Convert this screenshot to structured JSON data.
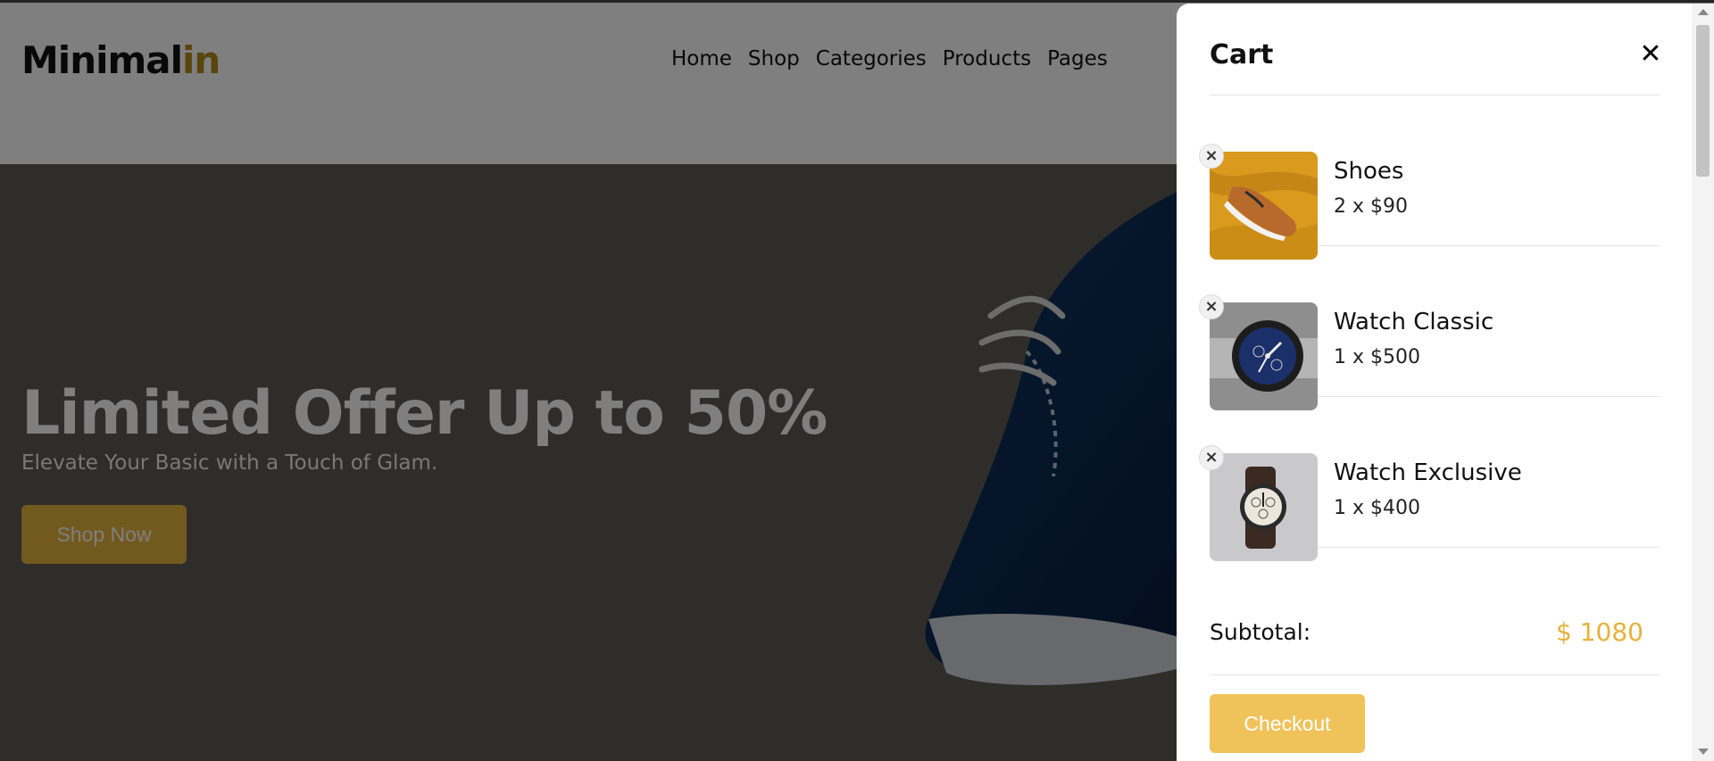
{
  "site": {
    "logo_main": "Minimal",
    "logo_accent": "in",
    "nav": [
      {
        "label": "Home"
      },
      {
        "label": "Shop"
      },
      {
        "label": "Categories"
      },
      {
        "label": "Products"
      },
      {
        "label": "Pages"
      }
    ]
  },
  "hero": {
    "title": "Limited Offer Up to 50%",
    "subtitle": "Elevate Your Basic with a Touch of Glam.",
    "cta_label": "Shop Now"
  },
  "cart": {
    "title": "Cart",
    "close_icon": "close-icon",
    "remove_icon": "×",
    "close_glyph": "✕",
    "items": [
      {
        "name": "Shoes",
        "qty_price": "2 x $90",
        "image": "shoe-thumbnail"
      },
      {
        "name": "Watch Classic",
        "qty_price": "1 x $500",
        "image": "watch-classic-thumbnail"
      },
      {
        "name": "Watch Exclusive",
        "qty_price": "1 x $400",
        "image": "watch-exclusive-thumbnail"
      }
    ],
    "subtotal_label": "Subtotal:",
    "subtotal_value": "$ 1080",
    "checkout_label": "Checkout"
  },
  "colors": {
    "accent": "#e5b23a",
    "logo_accent": "#b38a1a",
    "overlay": "rgba(0,0,0,0.5)"
  }
}
